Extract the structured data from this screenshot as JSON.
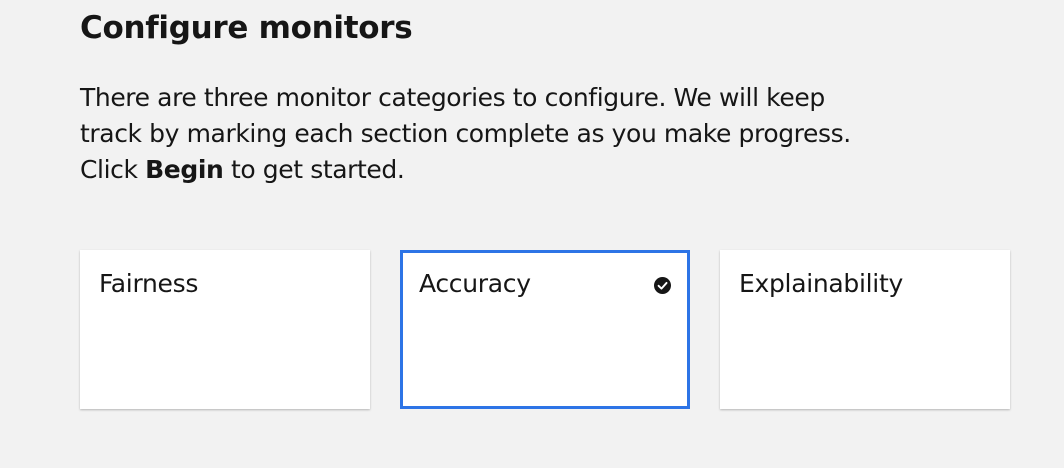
{
  "page": {
    "title": "Configure monitors",
    "intro_line_1": "There are three monitor categories to configure. We will keep",
    "intro_line_2": "track by marking each section complete as you make progress.",
    "intro_click": "Click",
    "intro_begin": "Begin",
    "intro_end": "to get started."
  },
  "cards": [
    {
      "label": "Fairness",
      "selected": false,
      "complete": false
    },
    {
      "label": "Accuracy",
      "selected": true,
      "complete": true,
      "status_icon": "checkmark-filled-icon"
    },
    {
      "label": "Explainability",
      "selected": false,
      "complete": false
    }
  ],
  "colors": {
    "background": "#f2f2f2",
    "card": "#ffffff",
    "selected_border": "#2d74e6",
    "text": "#161616"
  }
}
